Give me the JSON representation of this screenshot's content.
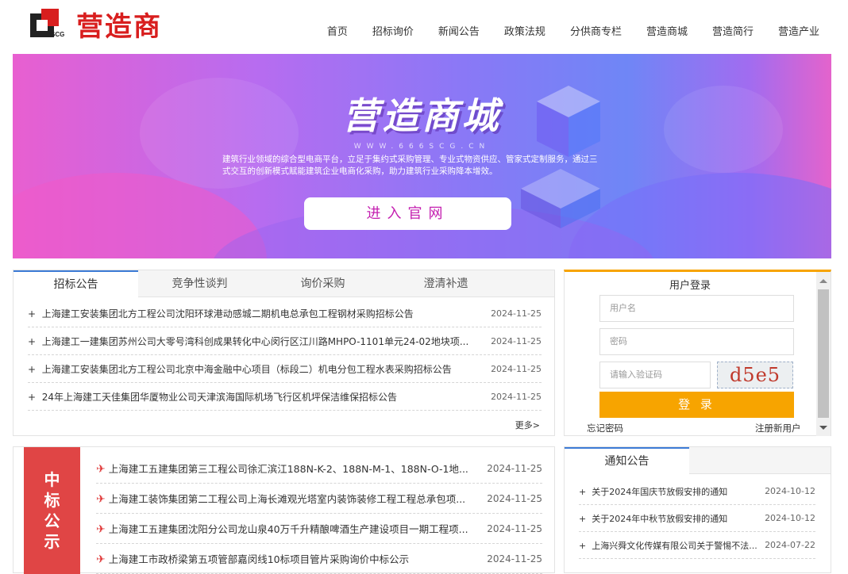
{
  "header": {
    "logo_text": "营造商",
    "logo_mark": "SCG",
    "nav": [
      "首页",
      "招标询价",
      "新闻公告",
      "政策法规",
      "分供商专栏",
      "营造商城",
      "营造简行",
      "营造产业"
    ]
  },
  "banner": {
    "title": "营造商城",
    "url": "WWW.666SCG.CN",
    "desc": "建筑行业领域的综合型电商平台，立足于集约式采购管理、专业式物资供应、管家式定制服务，通过三式交互的创新模式赋能建筑企业电商化采购，助力建筑行业采购降本增效。",
    "button": "进入官网"
  },
  "tender": {
    "tabs": [
      "招标公告",
      "竞争性谈判",
      "询价采购",
      "澄清补遗"
    ],
    "items": [
      {
        "title": "上海建工安装集团北方工程公司沈阳环球港动感城二期机电总承包工程钢材采购招标公告",
        "date": "2024-11-25"
      },
      {
        "title": "上海建工一建集团苏州公司大零号湾科创成果转化中心闵行区江川路MHPO-1101单元24-02地块项...",
        "date": "2024-11-25"
      },
      {
        "title": "上海建工安装集团北方工程公司北京中海金融中心项目（标段二）机电分包工程水表采购招标公告",
        "date": "2024-11-25"
      },
      {
        "title": "24年上海建工天佳集团华厦物业公司天津滨海国际机场飞行区机坪保洁维保招标公告",
        "date": "2024-11-25"
      }
    ],
    "more": "更多>"
  },
  "login": {
    "title": "用户登录",
    "username_ph": "用户名",
    "password_ph": "密码",
    "captcha_ph": "请输入验证码",
    "captcha": "d5e5",
    "submit": "登 录",
    "forgot": "忘记密码",
    "register": "注册新用户"
  },
  "award": {
    "label": [
      "中",
      "标",
      "公",
      "示"
    ],
    "items": [
      {
        "title": "上海建工五建集团第三工程公司徐汇滨江188N-K-2、188N-M-1、188N-O-1地...",
        "date": "2024-11-25"
      },
      {
        "title": "上海建工装饰集团第二工程公司上海长滩观光塔室内装饰装修工程工程总承包项...",
        "date": "2024-11-25"
      },
      {
        "title": "上海建工五建集团沈阳分公司龙山泉40万千升精酿啤酒生产建设项目一期工程项...",
        "date": "2024-11-25"
      },
      {
        "title": "上海建工市政桥梁第五项管部嘉闵线10标项目管片采购询价中标公示",
        "date": "2024-11-25"
      }
    ]
  },
  "notice": {
    "tab": "通知公告",
    "items": [
      {
        "title": "关于2024年国庆节放假安排的通知",
        "date": "2024-10-12"
      },
      {
        "title": "关于2024年中秋节放假安排的通知",
        "date": "2024-10-12"
      },
      {
        "title": "上海兴舜文化传媒有限公司关于警惕不法...",
        "date": "2024-07-22"
      }
    ]
  },
  "colors": {
    "brand": "#d81e1e",
    "accent": "#f7a400",
    "tab_blue": "#3d7bd6"
  }
}
